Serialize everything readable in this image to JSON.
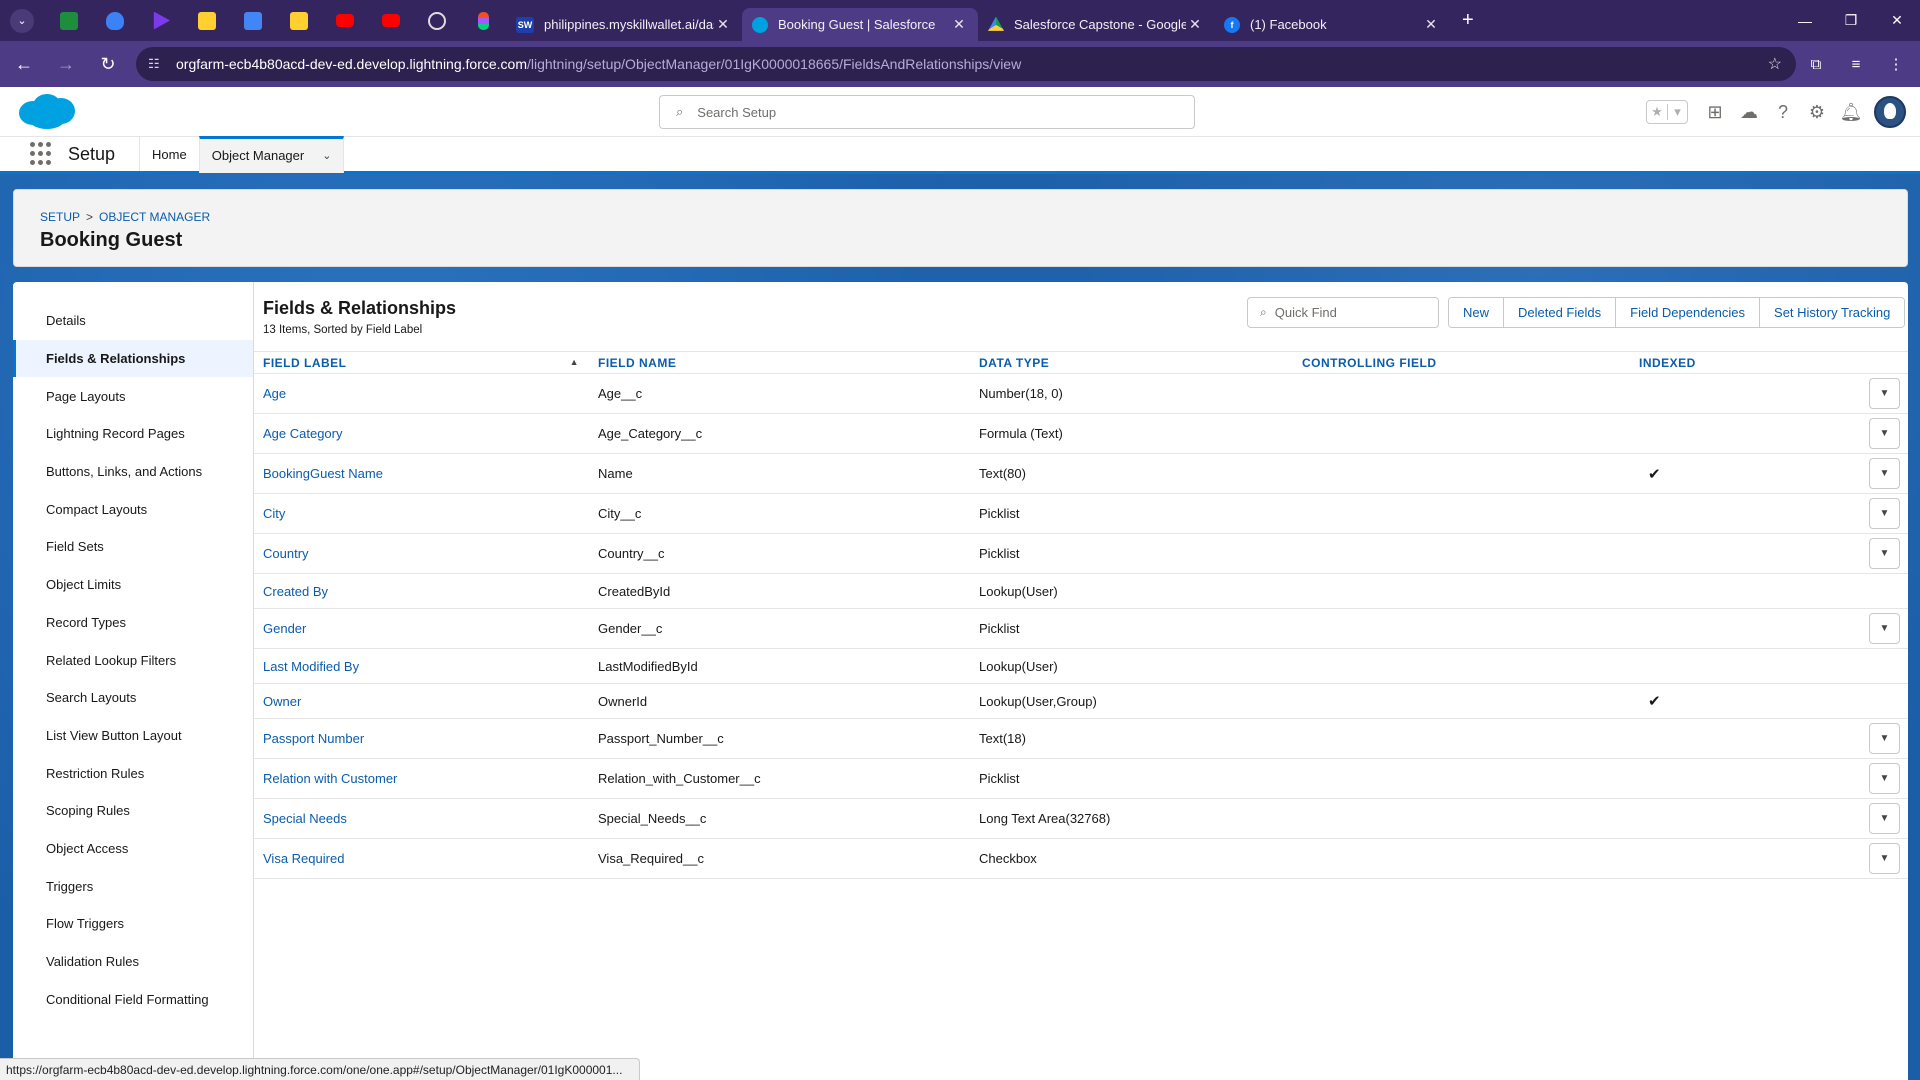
{
  "browser": {
    "tabs": [
      {
        "title": "philippines.myskillwallet.ai/das",
        "icon": "sw-icon"
      },
      {
        "title": "Booking Guest | Salesforce",
        "icon": "salesforce-icon"
      },
      {
        "title": "Salesforce Capstone - Google D",
        "icon": "google-drive-icon"
      },
      {
        "title": "(1) Facebook",
        "icon": "facebook-icon"
      }
    ],
    "sw_badge": "SW",
    "url_domain": "orgfarm-ecb4b80acd-dev-ed.develop.lightning.force.com",
    "url_path": "/lightning/setup/ObjectManager/01IgK0000018665/FieldsAndRelationships/view",
    "status_url": "https://orgfarm-ecb4b80acd-dev-ed.develop.lightning.force.com/one/one.app#/setup/ObjectManager/01IgK000001..."
  },
  "header": {
    "search_placeholder": "Search Setup"
  },
  "appnav": {
    "app_name": "Setup",
    "home": "Home",
    "object_manager": "Object Manager"
  },
  "page": {
    "crumb_setup": "Setup",
    "crumb_sep": ">",
    "crumb_object_manager": "Object Manager",
    "title": "Booking Guest"
  },
  "sidebar": {
    "items": [
      "Details",
      "Fields & Relationships",
      "Page Layouts",
      "Lightning Record Pages",
      "Buttons, Links, and Actions",
      "Compact Layouts",
      "Field Sets",
      "Object Limits",
      "Record Types",
      "Related Lookup Filters",
      "Search Layouts",
      "List View Button Layout",
      "Restriction Rules",
      "Scoping Rules",
      "Object Access",
      "Triggers",
      "Flow Triggers",
      "Validation Rules",
      "Conditional Field Formatting"
    ],
    "active_index": 1
  },
  "fields": {
    "title": "Fields & Relationships",
    "subtitle": "13 Items, Sorted by Field Label",
    "quick_find_placeholder": "Quick Find",
    "buttons": {
      "new": "New",
      "deleted_fields": "Deleted Fields",
      "field_dependencies": "Field Dependencies",
      "set_history_tracking": "Set History Tracking"
    },
    "columns": {
      "field_label": "FIELD LABEL",
      "field_name": "FIELD NAME",
      "data_type": "DATA TYPE",
      "controlling_field": "CONTROLLING FIELD",
      "indexed": "INDEXED"
    },
    "rows": [
      {
        "label": "Age",
        "name": "Age__c",
        "type": "Number(18, 0)",
        "controlling": "",
        "indexed": false,
        "menu": true
      },
      {
        "label": "Age Category",
        "name": "Age_Category__c",
        "type": "Formula (Text)",
        "controlling": "",
        "indexed": false,
        "menu": true
      },
      {
        "label": "BookingGuest Name",
        "name": "Name",
        "type": "Text(80)",
        "controlling": "",
        "indexed": true,
        "menu": true
      },
      {
        "label": "City",
        "name": "City__c",
        "type": "Picklist",
        "controlling": "",
        "indexed": false,
        "menu": true
      },
      {
        "label": "Country",
        "name": "Country__c",
        "type": "Picklist",
        "controlling": "",
        "indexed": false,
        "menu": true
      },
      {
        "label": "Created By",
        "name": "CreatedById",
        "type": "Lookup(User)",
        "controlling": "",
        "indexed": false,
        "menu": false
      },
      {
        "label": "Gender",
        "name": "Gender__c",
        "type": "Picklist",
        "controlling": "",
        "indexed": false,
        "menu": true
      },
      {
        "label": "Last Modified By",
        "name": "LastModifiedById",
        "type": "Lookup(User)",
        "controlling": "",
        "indexed": false,
        "menu": false
      },
      {
        "label": "Owner",
        "name": "OwnerId",
        "type": "Lookup(User,Group)",
        "controlling": "",
        "indexed": true,
        "menu": false
      },
      {
        "label": "Passport Number",
        "name": "Passport_Number__c",
        "type": "Text(18)",
        "controlling": "",
        "indexed": false,
        "menu": true
      },
      {
        "label": "Relation with Customer",
        "name": "Relation_with_Customer__c",
        "type": "Picklist",
        "controlling": "",
        "indexed": false,
        "menu": true
      },
      {
        "label": "Special Needs",
        "name": "Special_Needs__c",
        "type": "Long Text Area(32768)",
        "controlling": "",
        "indexed": false,
        "menu": true
      },
      {
        "label": "Visa Required",
        "name": "Visa_Required__c",
        "type": "Checkbox",
        "controlling": "",
        "indexed": false,
        "menu": true
      }
    ]
  },
  "colors": {
    "brand_blue": "#0176d3",
    "link_blue": "#0b5cab",
    "browser_purple": "#35255e"
  }
}
